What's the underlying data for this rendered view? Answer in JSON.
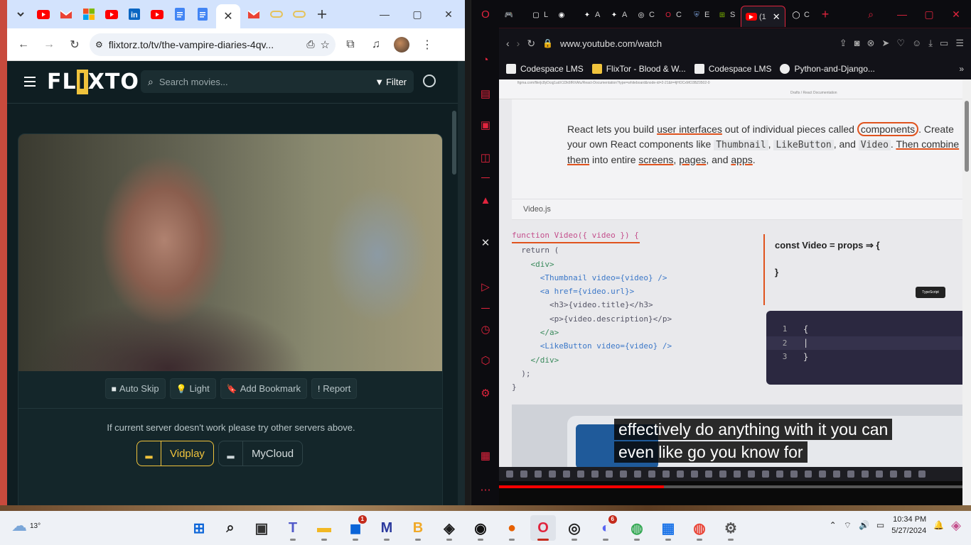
{
  "colors": {
    "flixtor_accent": "#f0c33c",
    "opera_red": "#e0243d",
    "yt_red": "#ff0000",
    "annotation_orange": "#e0531e"
  },
  "chrome": {
    "tab_icons": [
      "chevron-down-icon",
      "youtube-icon",
      "gmail-icon",
      "microsoft-icon",
      "youtube-icon",
      "linkedin-icon",
      "youtube-icon",
      "docs-icon",
      "docs-icon"
    ],
    "active_tab_close": "✕",
    "url": "flixtorz.to/tv/the-vampire-diaries-4qv..."
  },
  "flixtor": {
    "logo_pre": "FL",
    "logo_x": "I",
    "logo_post": "XTOR",
    "search_placeholder": "Search movies...",
    "filter_label": "Filter",
    "controls": [
      {
        "icon": "■",
        "label": "Auto Skip"
      },
      {
        "icon": "💡",
        "label": "Light"
      },
      {
        "icon": "🔖",
        "label": "Add Bookmark"
      },
      {
        "icon": "!",
        "label": "Report"
      }
    ],
    "server_note": "If current server doesn't work please try other servers above.",
    "servers": [
      {
        "label": "Vidplay",
        "selected": true
      },
      {
        "label": "MyCloud",
        "selected": false
      }
    ]
  },
  "opera": {
    "tabs": [
      {
        "fav": "🎮",
        "label": ""
      },
      {
        "fav": "▢",
        "label": "L"
      },
      {
        "fav": "◉",
        "label": ""
      },
      {
        "fav": "✦",
        "label": "A"
      },
      {
        "fav": "✦",
        "label": "A"
      },
      {
        "fav": "◎",
        "label": "C"
      },
      {
        "fav": "O",
        "label": "C"
      },
      {
        "fav": "⛨",
        "label": "E"
      },
      {
        "fav": "⊞",
        "label": "S"
      },
      {
        "fav": "▶",
        "label": "(1"
      },
      {
        "fav": "◯",
        "label": "C"
      }
    ],
    "url": "www.youtube.com/watch",
    "bookmarks": [
      "Codespace LMS",
      "FlixTor - Blood & W...",
      "Codespace LMS",
      "Python-and-Django..."
    ]
  },
  "youtube": {
    "figma_url": "figma.com/file/jc8yDcqj1udX1Dk6fRXAfu/React-Documentation?type=whiteboard&node-id=2-21&t=4jHOCxMO3BZ0502-0",
    "figma_title": "Drafts / React Documentation",
    "doc": {
      "t1": "React lets you build ",
      "u1": "user interfaces",
      "t2": " out of individual pieces called ",
      "c1": "components",
      "t3": ". Create your own React components like ",
      "k1": "Thumbnail",
      "t4": ", ",
      "k2": "LikeButton",
      "t5": ", and ",
      "k3": "Video",
      "t6": ". ",
      "u2": "Then combine them",
      "t7": " into entire ",
      "u3": "screens",
      "t8": ", ",
      "u4": "pages",
      "t9": ", and ",
      "u5": "apps",
      "t10": "."
    },
    "file_label": "Video.js",
    "code": [
      "function Video({ video }) {",
      "  return (",
      "    <div>",
      "      <Thumbnail video={video} />",
      "      <a href={video.url}>",
      "        <h3>{video.title}</h3>",
      "        <p>{video.description}</p>",
      "      </a>",
      "      <LikeButton video={video} />",
      "    </div>",
      "  );",
      "}"
    ],
    "handwritten_top": "const Video = props ⇒ {",
    "handwritten_bottom": "}",
    "tooltip": "TypeScript",
    "editor_lines": [
      {
        "num": "1",
        "text": "{"
      },
      {
        "num": "2",
        "text": ""
      },
      {
        "num": "3",
        "text": "}"
      }
    ],
    "captions": [
      "effectively do anything with it you can",
      "even like go you know for"
    ],
    "progress_fraction": 0.35
  },
  "taskbar": {
    "temperature": "13°",
    "time": "10:34 PM",
    "date": "5/27/2024",
    "apps": [
      {
        "name": "start-icon",
        "glyph": "⊞",
        "color": "#0a64d8"
      },
      {
        "name": "search-icon",
        "glyph": "⌕",
        "color": "#222"
      },
      {
        "name": "task-view-icon",
        "glyph": "▣",
        "color": "#333"
      },
      {
        "name": "teams-icon",
        "glyph": "T",
        "color": "#5059c9"
      },
      {
        "name": "file-explorer-icon",
        "glyph": "▬",
        "color": "#f2b824"
      },
      {
        "name": "store-icon",
        "glyph": "◼",
        "color": "#0a64d8",
        "badge": "1"
      },
      {
        "name": "app-m-icon",
        "glyph": "M",
        "color": "#2b3a9e"
      },
      {
        "name": "app-b-icon",
        "glyph": "B",
        "color": "#f0a928"
      },
      {
        "name": "figma-icon",
        "glyph": "◈",
        "color": "#1e1e1e"
      },
      {
        "name": "github-icon",
        "glyph": "◉",
        "color": "#111"
      },
      {
        "name": "firefox-icon",
        "glyph": "●",
        "color": "#e66000"
      },
      {
        "name": "opera-icon",
        "glyph": "O",
        "color": "#e0243d",
        "active": true
      },
      {
        "name": "app-dark-icon",
        "glyph": "◎",
        "color": "#222"
      },
      {
        "name": "discord-icon",
        "glyph": "◐",
        "color": "#5865f2",
        "badge": "6"
      },
      {
        "name": "chrome-icon",
        "glyph": "◍",
        "color": "#34a853"
      },
      {
        "name": "calendar-icon",
        "glyph": "▦",
        "color": "#1a73e8"
      },
      {
        "name": "chrome-alt-icon",
        "glyph": "◍",
        "color": "#ea4335"
      },
      {
        "name": "settings-icon",
        "glyph": "⚙",
        "color": "#555"
      }
    ]
  }
}
